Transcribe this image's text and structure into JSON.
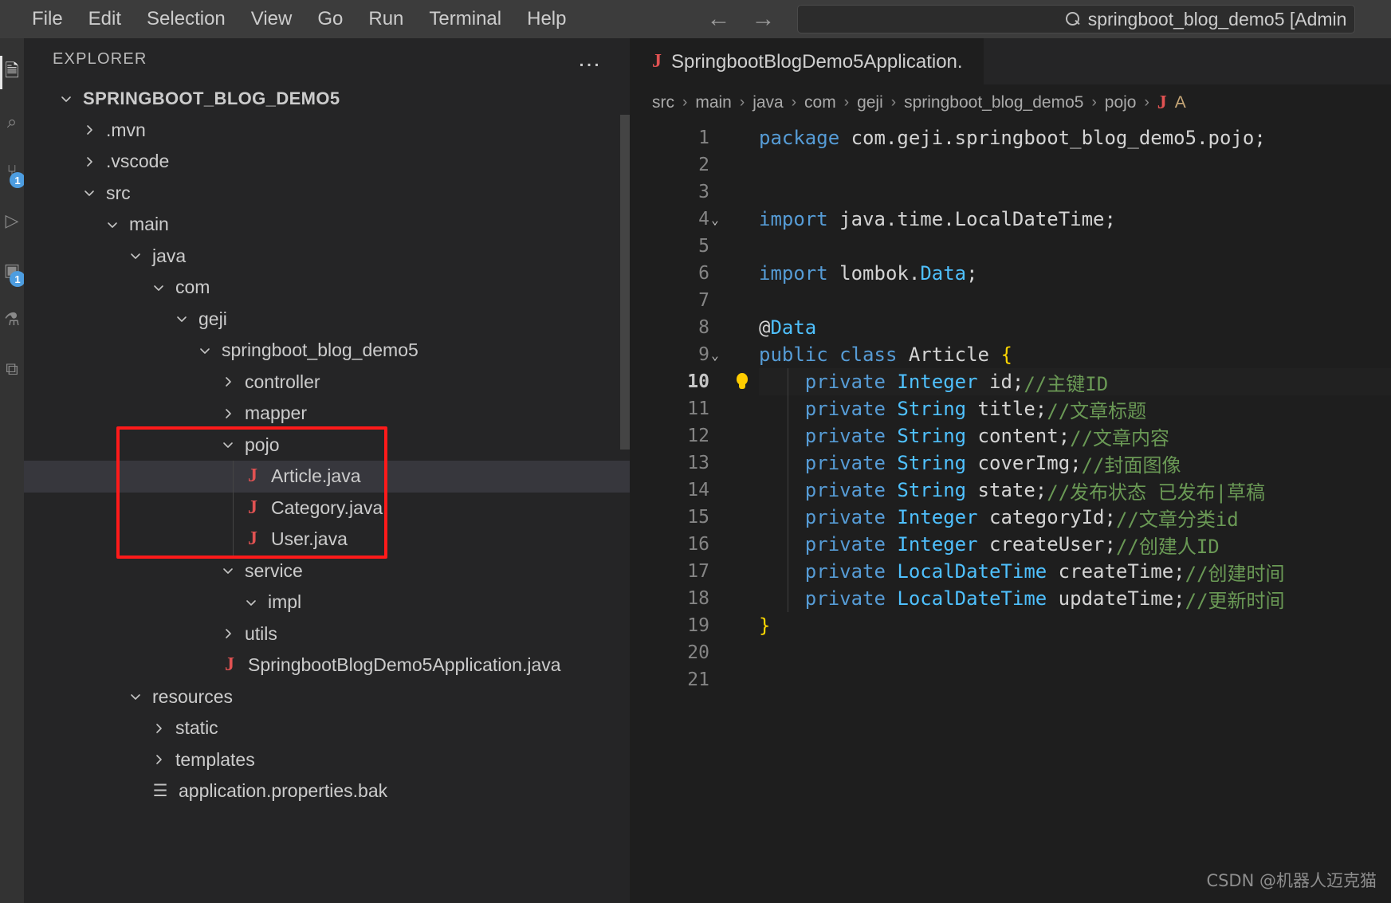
{
  "titlebar": {
    "menus": [
      "File",
      "Edit",
      "Selection",
      "View",
      "Go",
      "Run",
      "Terminal",
      "Help"
    ],
    "back_icon": "←",
    "forward_icon": "→",
    "search_value": "springboot_blog_demo5 [Admin",
    "search_icon": "search-icon"
  },
  "activitybar": {
    "items": [
      {
        "name": "explorer",
        "glyph": "🗎",
        "badge": ""
      },
      {
        "name": "search",
        "glyph": "⌕",
        "badge": ""
      },
      {
        "name": "source-control",
        "glyph": "⑂",
        "badge": "1"
      },
      {
        "name": "run-and-debug",
        "glyph": "▷",
        "badge": ""
      },
      {
        "name": "extensions",
        "glyph": "▣",
        "badge": "1"
      },
      {
        "name": "testing",
        "glyph": "⚗",
        "badge": ""
      },
      {
        "name": "remote",
        "glyph": "⧉",
        "badge": ""
      }
    ]
  },
  "sidebar": {
    "title": "EXPLORER",
    "more_actions": "…",
    "root": "SPRINGBOOT_BLOG_DEMO5",
    "tree": [
      {
        "label": ".mvn",
        "depth": 1,
        "kind": "folder",
        "expanded": false
      },
      {
        "label": ".vscode",
        "depth": 1,
        "kind": "folder",
        "expanded": false
      },
      {
        "label": "src",
        "depth": 1,
        "kind": "folder",
        "expanded": true
      },
      {
        "label": "main",
        "depth": 2,
        "kind": "folder",
        "expanded": true
      },
      {
        "label": "java",
        "depth": 3,
        "kind": "folder",
        "expanded": true
      },
      {
        "label": "com",
        "depth": 4,
        "kind": "folder",
        "expanded": true
      },
      {
        "label": "geji",
        "depth": 5,
        "kind": "folder",
        "expanded": true
      },
      {
        "label": "springboot_blog_demo5",
        "depth": 6,
        "kind": "folder",
        "expanded": true
      },
      {
        "label": "controller",
        "depth": 7,
        "kind": "folder",
        "expanded": false
      },
      {
        "label": "mapper",
        "depth": 7,
        "kind": "folder",
        "expanded": false
      },
      {
        "label": "pojo",
        "depth": 7,
        "kind": "folder",
        "expanded": true
      },
      {
        "label": "Article.java",
        "depth": 8,
        "kind": "java",
        "selected": true
      },
      {
        "label": "Category.java",
        "depth": 8,
        "kind": "java"
      },
      {
        "label": "User.java",
        "depth": 8,
        "kind": "java"
      },
      {
        "label": "service",
        "depth": 7,
        "kind": "folder",
        "expanded": true
      },
      {
        "label": "impl",
        "depth": 8,
        "kind": "folder",
        "expanded": true
      },
      {
        "label": "utils",
        "depth": 7,
        "kind": "folder",
        "expanded": false
      },
      {
        "label": "SpringbootBlogDemo5Application.java",
        "depth": 7,
        "kind": "java"
      },
      {
        "label": "resources",
        "depth": 3,
        "kind": "folder",
        "expanded": true
      },
      {
        "label": "static",
        "depth": 4,
        "kind": "folder",
        "expanded": false
      },
      {
        "label": "templates",
        "depth": 4,
        "kind": "folder",
        "expanded": false
      },
      {
        "label": "application.properties.bak",
        "depth": 4,
        "kind": "props"
      }
    ],
    "annotation": {
      "color": "#ff1a1a",
      "covers": [
        "pojo",
        "Article.java",
        "Category.java",
        "User.java"
      ]
    }
  },
  "editor": {
    "tab": {
      "label": "SpringbootBlogDemo5Application.",
      "icon": "java-icon"
    },
    "breadcrumb": [
      "src",
      "main",
      "java",
      "com",
      "geji",
      "springboot_blog_demo5",
      "pojo"
    ],
    "breadcrumb_sep": "›",
    "breadcrumb_file_icon": "java-icon",
    "breadcrumb_tail": "A",
    "current_line": 10
  },
  "debug_toolbar": {
    "buttons": [
      {
        "name": "drag-handle-icon",
        "label": ""
      },
      {
        "name": "pause-icon",
        "label": ""
      },
      {
        "name": "step-over-icon",
        "label": ""
      },
      {
        "name": "step-into-icon",
        "label": ""
      },
      {
        "name": "step-out-icon",
        "label": ""
      },
      {
        "name": "restart-icon",
        "label": ""
      },
      {
        "name": "stop-icon",
        "label": ""
      },
      {
        "name": "chevron-down-icon",
        "label": "⌄"
      }
    ],
    "colors": {
      "pause": "#75beff",
      "step": "#4a7a9b",
      "restart": "#89d185",
      "stop": "#f48771"
    }
  },
  "code": {
    "lines": [
      {
        "n": 1,
        "fold": "",
        "tokens": [
          {
            "t": "package ",
            "c": "k-kw"
          },
          {
            "t": "com.geji.springboot_blog_demo5.pojo;",
            "c": "k-plain"
          }
        ]
      },
      {
        "n": 2,
        "fold": "",
        "tokens": []
      },
      {
        "n": 3,
        "fold": "",
        "tokens": []
      },
      {
        "n": 4,
        "fold": "⌄",
        "tokens": [
          {
            "t": "import ",
            "c": "k-kw"
          },
          {
            "t": "java.time.",
            "c": "k-plain"
          },
          {
            "t": "LocalDateTime",
            "c": "k-plain"
          },
          {
            "t": ";",
            "c": "k-plain"
          }
        ]
      },
      {
        "n": 5,
        "fold": "",
        "tokens": []
      },
      {
        "n": 6,
        "fold": "",
        "tokens": [
          {
            "t": "import ",
            "c": "k-kw"
          },
          {
            "t": "lombok.",
            "c": "k-plain"
          },
          {
            "t": "Data",
            "c": "k-cls"
          },
          {
            "t": ";",
            "c": "k-plain"
          }
        ]
      },
      {
        "n": 7,
        "fold": "",
        "tokens": []
      },
      {
        "n": 8,
        "fold": "",
        "tokens": [
          {
            "t": "@",
            "c": "k-plain"
          },
          {
            "t": "Data",
            "c": "k-cls"
          }
        ]
      },
      {
        "n": 9,
        "fold": "⌄",
        "tokens": [
          {
            "t": "public ",
            "c": "k-kw"
          },
          {
            "t": "class ",
            "c": "k-kw"
          },
          {
            "t": "Article ",
            "c": "k-plain"
          },
          {
            "t": "{",
            "c": "k-brace"
          }
        ]
      },
      {
        "n": 10,
        "fold": "",
        "glyph": "lightbulb-icon",
        "current": true,
        "tokens": [
          {
            "t": "    ",
            "c": "k-plain"
          },
          {
            "t": "private ",
            "c": "k-kw"
          },
          {
            "t": "Integer",
            "c": "k-cls"
          },
          {
            "t": " id;",
            "c": "k-plain"
          },
          {
            "t": "//主键ID",
            "c": "k-cmt"
          }
        ]
      },
      {
        "n": 11,
        "fold": "",
        "tokens": [
          {
            "t": "    ",
            "c": "k-plain"
          },
          {
            "t": "private ",
            "c": "k-kw"
          },
          {
            "t": "String",
            "c": "k-cls"
          },
          {
            "t": " title;",
            "c": "k-plain"
          },
          {
            "t": "//文章标题",
            "c": "k-cmt"
          }
        ]
      },
      {
        "n": 12,
        "fold": "",
        "tokens": [
          {
            "t": "    ",
            "c": "k-plain"
          },
          {
            "t": "private ",
            "c": "k-kw"
          },
          {
            "t": "String",
            "c": "k-cls"
          },
          {
            "t": " content;",
            "c": "k-plain"
          },
          {
            "t": "//文章内容",
            "c": "k-cmt"
          }
        ]
      },
      {
        "n": 13,
        "fold": "",
        "tokens": [
          {
            "t": "    ",
            "c": "k-plain"
          },
          {
            "t": "private ",
            "c": "k-kw"
          },
          {
            "t": "String",
            "c": "k-cls"
          },
          {
            "t": " coverImg;",
            "c": "k-plain"
          },
          {
            "t": "//封面图像",
            "c": "k-cmt"
          }
        ]
      },
      {
        "n": 14,
        "fold": "",
        "tokens": [
          {
            "t": "    ",
            "c": "k-plain"
          },
          {
            "t": "private ",
            "c": "k-kw"
          },
          {
            "t": "String",
            "c": "k-cls"
          },
          {
            "t": " state;",
            "c": "k-plain"
          },
          {
            "t": "//发布状态 已发布|草稿",
            "c": "k-cmt"
          }
        ]
      },
      {
        "n": 15,
        "fold": "",
        "tokens": [
          {
            "t": "    ",
            "c": "k-plain"
          },
          {
            "t": "private ",
            "c": "k-kw"
          },
          {
            "t": "Integer",
            "c": "k-cls"
          },
          {
            "t": " categoryId;",
            "c": "k-plain"
          },
          {
            "t": "//文章分类id",
            "c": "k-cmt"
          }
        ]
      },
      {
        "n": 16,
        "fold": "",
        "tokens": [
          {
            "t": "    ",
            "c": "k-plain"
          },
          {
            "t": "private ",
            "c": "k-kw"
          },
          {
            "t": "Integer",
            "c": "k-cls"
          },
          {
            "t": " createUser;",
            "c": "k-plain"
          },
          {
            "t": "//创建人ID",
            "c": "k-cmt"
          }
        ]
      },
      {
        "n": 17,
        "fold": "",
        "tokens": [
          {
            "t": "    ",
            "c": "k-plain"
          },
          {
            "t": "private ",
            "c": "k-kw"
          },
          {
            "t": "LocalDateTime",
            "c": "k-cls"
          },
          {
            "t": " createTime;",
            "c": "k-plain"
          },
          {
            "t": "//创建时间",
            "c": "k-cmt"
          }
        ]
      },
      {
        "n": 18,
        "fold": "",
        "tokens": [
          {
            "t": "    ",
            "c": "k-plain"
          },
          {
            "t": "private ",
            "c": "k-kw"
          },
          {
            "t": "LocalDateTime",
            "c": "k-cls"
          },
          {
            "t": " updateTime;",
            "c": "k-plain"
          },
          {
            "t": "//更新时间",
            "c": "k-cmt"
          }
        ]
      },
      {
        "n": 19,
        "fold": "",
        "tokens": [
          {
            "t": "}",
            "c": "k-brace"
          }
        ]
      },
      {
        "n": 20,
        "fold": "",
        "tokens": []
      },
      {
        "n": 21,
        "fold": "",
        "tokens": []
      }
    ]
  },
  "watermark": "CSDN @机器人迈克猫"
}
